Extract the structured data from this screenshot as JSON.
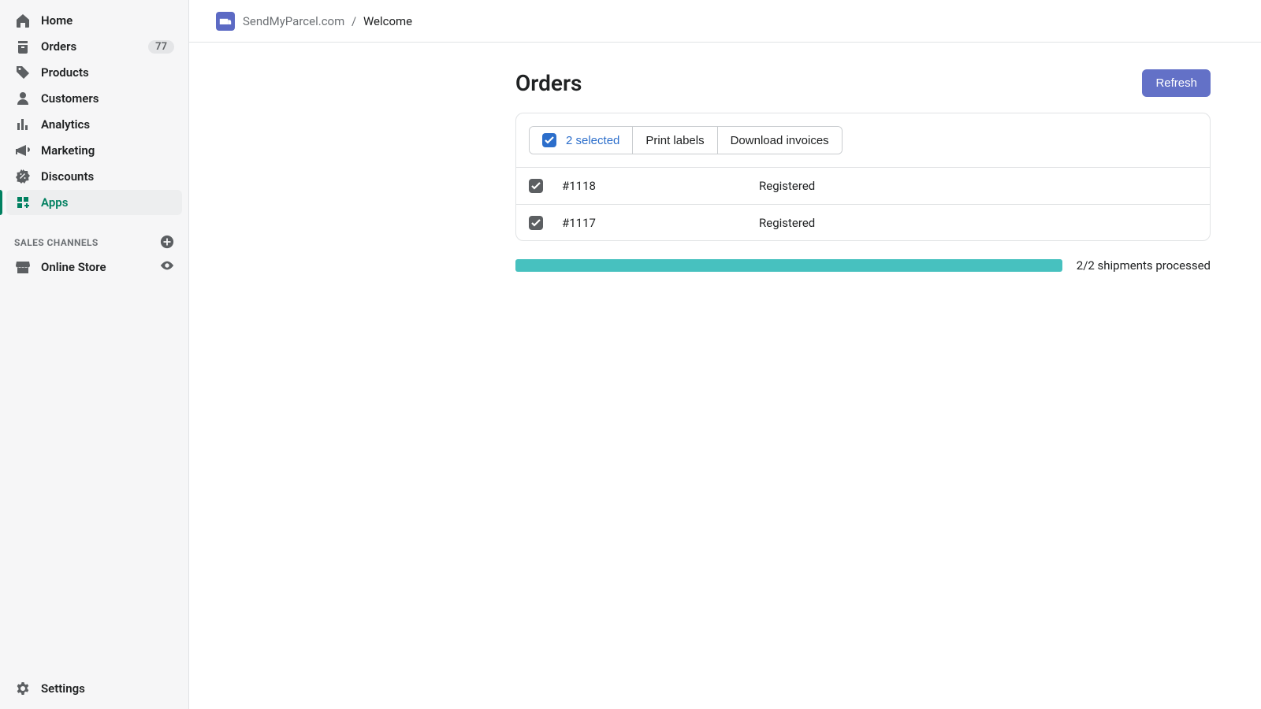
{
  "sidebar": {
    "items": [
      {
        "label": "Home"
      },
      {
        "label": "Orders",
        "badge": "77"
      },
      {
        "label": "Products"
      },
      {
        "label": "Customers"
      },
      {
        "label": "Analytics"
      },
      {
        "label": "Marketing"
      },
      {
        "label": "Discounts"
      },
      {
        "label": "Apps"
      }
    ],
    "section_title": "SALES CHANNELS",
    "channels": [
      {
        "label": "Online Store"
      }
    ],
    "settings_label": "Settings"
  },
  "breadcrumb": {
    "app": "SendMyParcel.com",
    "page": "Welcome"
  },
  "page": {
    "title": "Orders",
    "refresh_label": "Refresh"
  },
  "toolbar": {
    "selected_label": "2 selected",
    "print_labels_label": "Print labels",
    "download_invoices_label": "Download invoices"
  },
  "rows": [
    {
      "id": "#1118",
      "status": "Registered"
    },
    {
      "id": "#1117",
      "status": "Registered"
    }
  ],
  "progress": {
    "label": "2/2 shipments processed",
    "percent": "100"
  }
}
